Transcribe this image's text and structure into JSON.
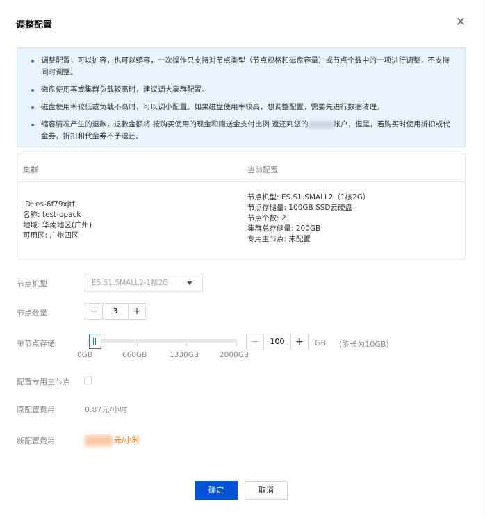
{
  "dialog": {
    "title": "调整配置",
    "close_icon": "close-icon"
  },
  "notice": {
    "items": [
      "调整配置，可以扩容，也可以缩容，一次操作只支持对节点类型（节点规格和磁盘容量）或节点个数中的一项进行调整，不支持同时调整。",
      "磁盘使用率或集群负载较高时，建议调大集群配置。",
      "磁盘使用率较低或负载不高时，可以调小配置。如果磁盘使用率较高，想调整配置，需要先进行数据清理。",
      "缩容情况产生的退款，退款金额将 按购买使用的现金和赠送金支付比例 返还到您的",
      "账户，但是，若购买时使用折扣或代金券，折扣和代金券不予退还。"
    ]
  },
  "cluster_table": {
    "col_cluster": "集群",
    "col_current": "当前配置",
    "cluster_info": [
      "ID: es-6f79xjtf",
      "名称: test-opack",
      "地域: 华南地区(广州)",
      "可用区: 广州四区"
    ],
    "current_config": [
      "节点机型: ES.S1.SMALL2（1核2G）",
      "节点存储量: 100GB SSD云硬盘",
      "节点个数: 2",
      "集群总存储量: 200GB",
      "专用主节点: 未配置"
    ]
  },
  "form": {
    "node_type_label": "节点机型",
    "node_type_value": "ES.S1.SMALL2-1核2G",
    "node_count_label": "节点数量",
    "node_count_value": "3",
    "storage_label": "单节点存储",
    "storage_value": "100",
    "storage_unit": "GB",
    "storage_step": "(步长为10GB)",
    "storage_level": 0.05,
    "storage_ticks": [
      "0GB",
      "660GB",
      "1330GB",
      "2000GB"
    ],
    "master_label": "配置专用主节点",
    "orig_price_label": "原配置费用",
    "orig_price_value": "0.87元/小时",
    "new_price_label": "新配置费用",
    "new_price_suffix": "元/小时"
  },
  "buttons": {
    "ok": "确定",
    "cancel": "取消",
    "minus": "−",
    "plus": "+"
  }
}
